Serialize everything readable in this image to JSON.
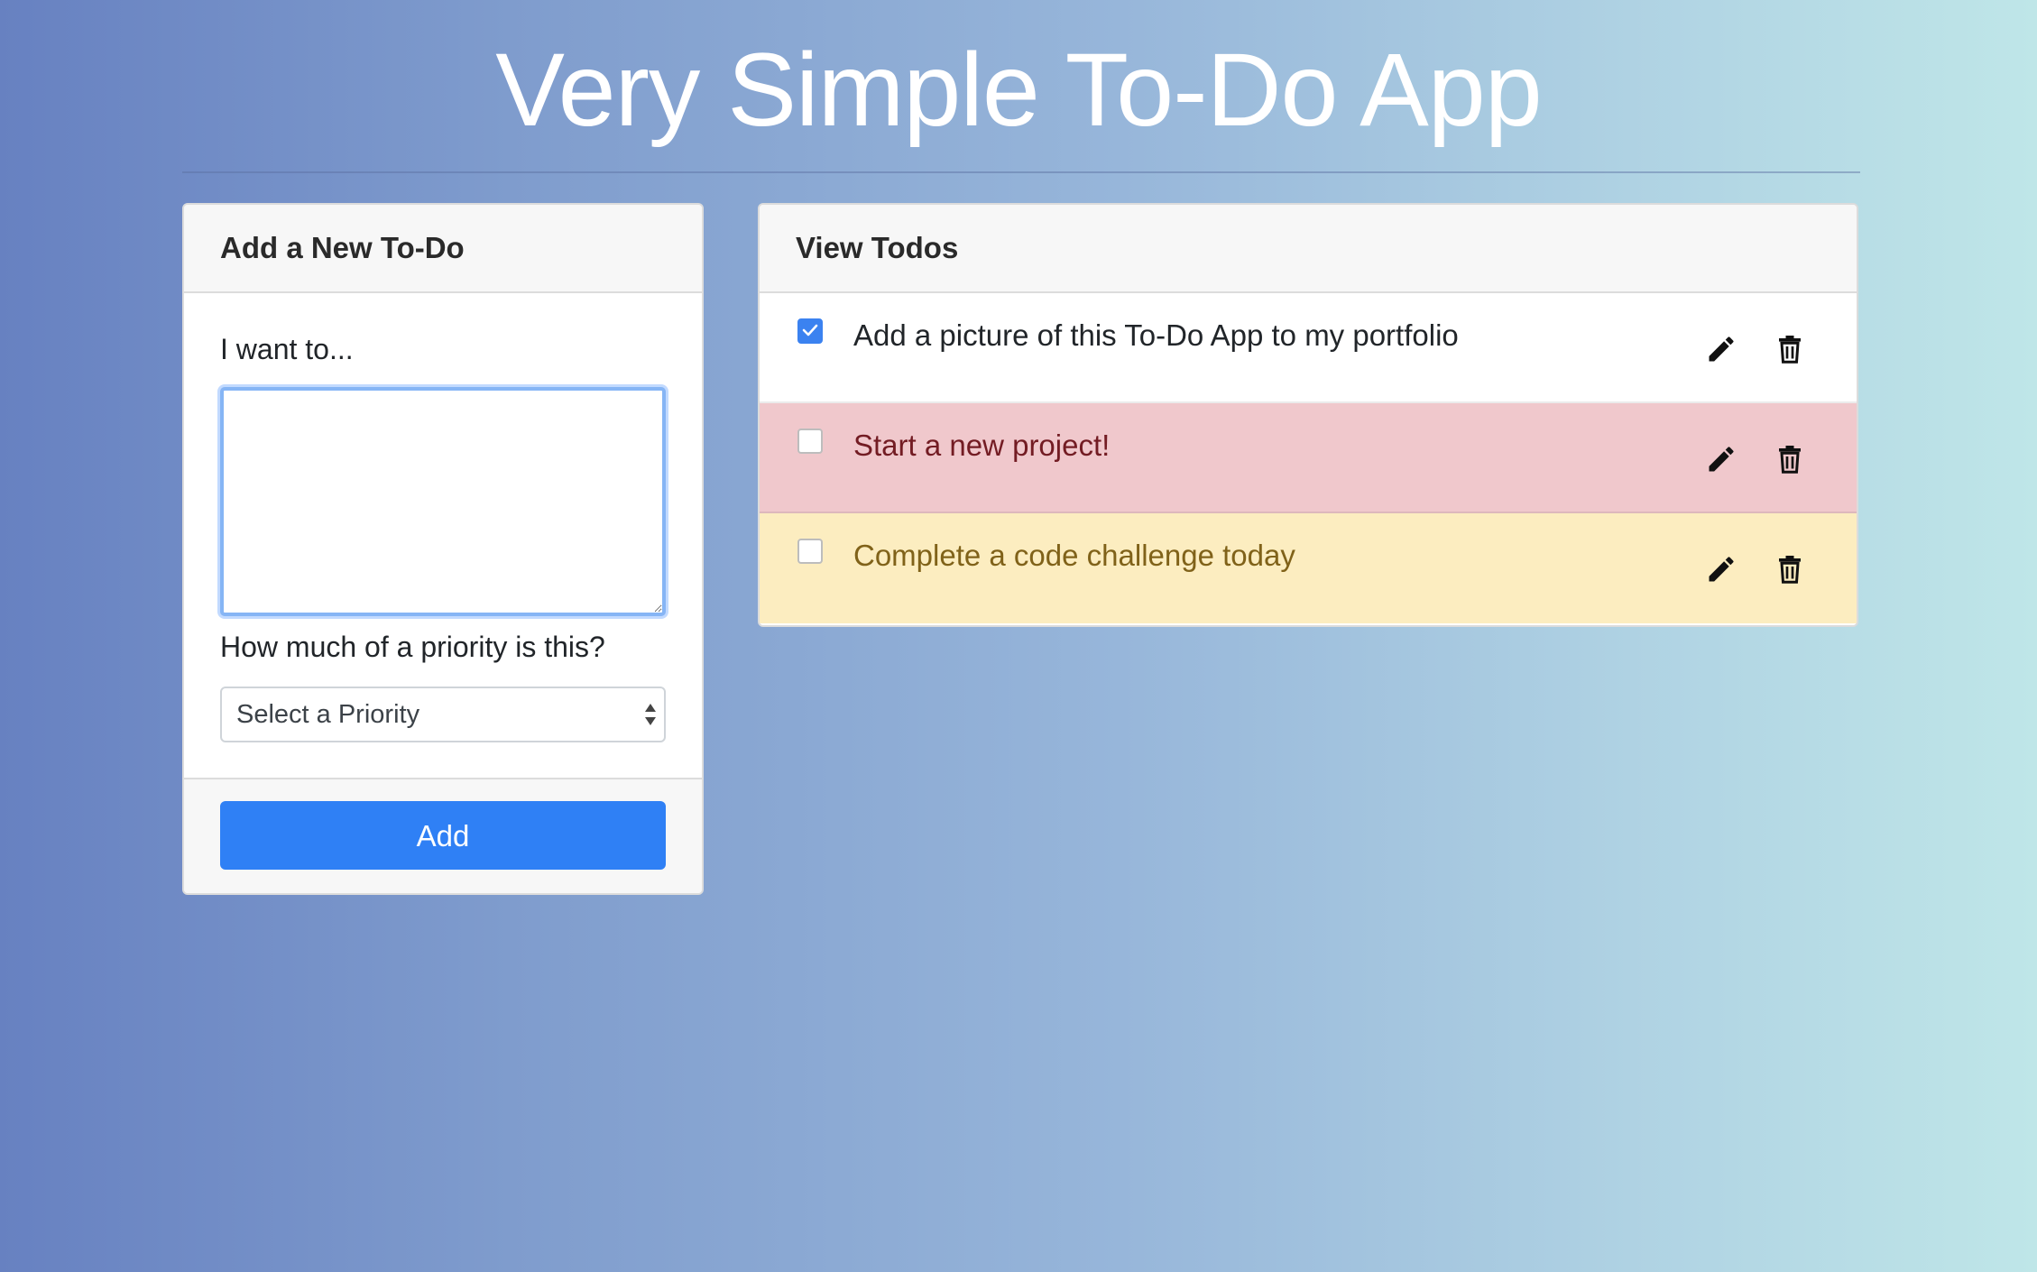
{
  "header": {
    "title": "Very Simple To-Do App"
  },
  "add_panel": {
    "title": "Add a New To-Do",
    "text_label": "I want to...",
    "text_value": "",
    "priority_label": "How much of a priority is this?",
    "priority_selected": "Select a Priority",
    "add_button_label": "Add"
  },
  "view_panel": {
    "title": "View Todos",
    "todos": [
      {
        "text": "Add a picture of this To-Do App to my portfolio",
        "completed": true,
        "row_color": "#ffffff",
        "text_color": "#212529"
      },
      {
        "text": "Start a new project!",
        "completed": false,
        "row_color": "#f0c8cc",
        "text_color": "#731c23"
      },
      {
        "text": "Complete a code challenge today",
        "completed": false,
        "row_color": "#fcedc0",
        "text_color": "#806219"
      }
    ],
    "icons": {
      "edit": "pencil-icon",
      "delete": "trash-icon"
    }
  },
  "colors": {
    "accent": "#2f80f5",
    "background_start": "#6781c1",
    "background_end": "#bfe6e8"
  }
}
